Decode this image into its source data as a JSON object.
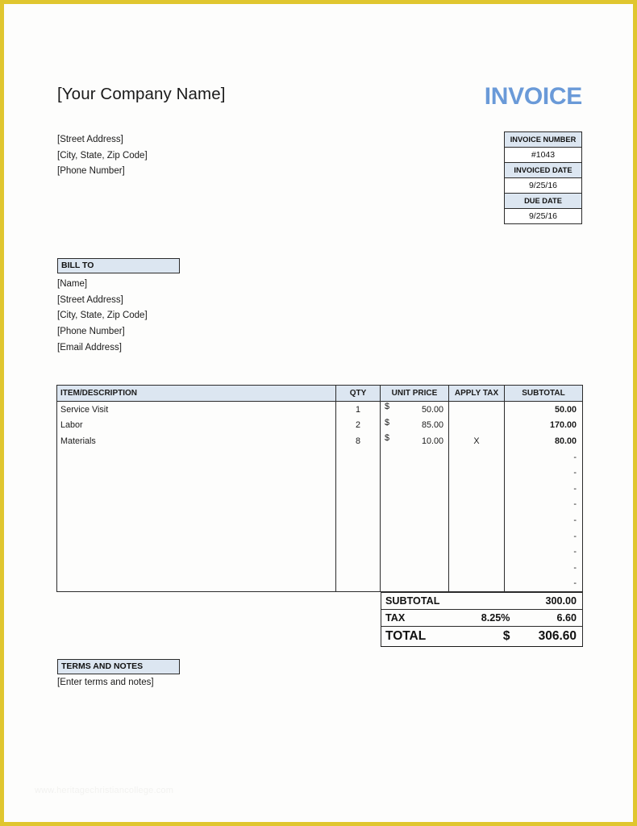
{
  "company": {
    "name": "[Your Company Name]",
    "address_lines": [
      "[Street Address]",
      "[City, State, Zip Code]",
      "[Phone Number]"
    ]
  },
  "document": {
    "title": "INVOICE",
    "title_color": "#6a9ad8"
  },
  "meta": {
    "rows": [
      {
        "label": "INVOICE NUMBER",
        "value": "#1043"
      },
      {
        "label": "INVOICED DATE",
        "value": "9/25/16"
      },
      {
        "label": "DUE DATE",
        "value": "9/25/16"
      }
    ]
  },
  "bill_to": {
    "heading": "BILL TO",
    "lines": [
      "[Name]",
      "[Street Address]",
      "[City, State, Zip Code]",
      "[Phone Number]",
      "[Email Address]"
    ]
  },
  "items_table": {
    "headers": {
      "description": "ITEM/DESCRIPTION",
      "qty": "QTY",
      "unit_price": "UNIT PRICE",
      "apply_tax": "APPLY TAX",
      "subtotal": "SUBTOTAL"
    },
    "currency_symbol": "$",
    "rows": [
      {
        "description": "Service Visit",
        "qty": "1",
        "currency": "$",
        "unit_price": "50.00",
        "apply_tax": "",
        "subtotal": "50.00"
      },
      {
        "description": "Labor",
        "qty": "2",
        "currency": "$",
        "unit_price": "85.00",
        "apply_tax": "",
        "subtotal": "170.00"
      },
      {
        "description": "Materials",
        "qty": "8",
        "currency": "$",
        "unit_price": "10.00",
        "apply_tax": "X",
        "subtotal": "80.00"
      },
      {
        "description": "",
        "qty": "",
        "currency": "",
        "unit_price": "",
        "apply_tax": "",
        "subtotal": "-"
      },
      {
        "description": "",
        "qty": "",
        "currency": "",
        "unit_price": "",
        "apply_tax": "",
        "subtotal": "-"
      },
      {
        "description": "",
        "qty": "",
        "currency": "",
        "unit_price": "",
        "apply_tax": "",
        "subtotal": "-"
      },
      {
        "description": "",
        "qty": "",
        "currency": "",
        "unit_price": "",
        "apply_tax": "",
        "subtotal": "-"
      },
      {
        "description": "",
        "qty": "",
        "currency": "",
        "unit_price": "",
        "apply_tax": "",
        "subtotal": "-"
      },
      {
        "description": "",
        "qty": "",
        "currency": "",
        "unit_price": "",
        "apply_tax": "",
        "subtotal": "-"
      },
      {
        "description": "",
        "qty": "",
        "currency": "",
        "unit_price": "",
        "apply_tax": "",
        "subtotal": "-"
      },
      {
        "description": "",
        "qty": "",
        "currency": "",
        "unit_price": "",
        "apply_tax": "",
        "subtotal": "-"
      },
      {
        "description": "",
        "qty": "",
        "currency": "",
        "unit_price": "",
        "apply_tax": "",
        "subtotal": "-"
      }
    ]
  },
  "totals": {
    "subtotal_label": "SUBTOTAL",
    "subtotal_mid": "",
    "subtotal_value": "300.00",
    "tax_label": "TAX",
    "tax_rate": "8.25%",
    "tax_value": "6.60",
    "total_label": "TOTAL",
    "total_currency": "$",
    "total_value": "306.60"
  },
  "terms": {
    "heading": "TERMS AND NOTES",
    "body": "[Enter terms and notes]"
  },
  "watermark": "www.heritagechristiancollege.com",
  "theme": {
    "header_fill": "#dce6f1",
    "border": "#2b2b2b",
    "page_border": "#e0c62f"
  }
}
